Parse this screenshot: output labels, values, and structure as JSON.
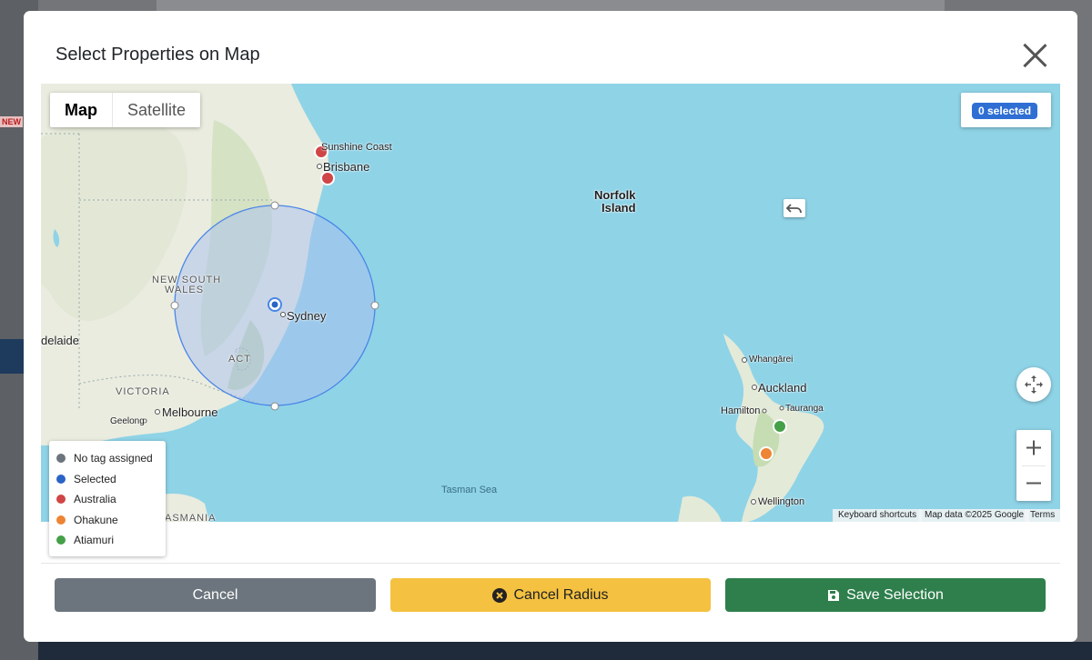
{
  "background": {
    "new_badge": "NEW"
  },
  "modal": {
    "title": "Select Properties on Map"
  },
  "map": {
    "type_controls": {
      "map": "Map",
      "satellite": "Satellite",
      "active": "Map"
    },
    "selected_count": "0 selected",
    "labels": {
      "sunshine_coast": "Sunshine Coast",
      "brisbane": "Brisbane",
      "norfolk": "Norfolk",
      "island": "Island",
      "new_south": "NEW SOUTH",
      "wales": "WALES",
      "sydney": "Sydney",
      "adelaide": "delaide",
      "act": "ACT",
      "victoria": "VICTORIA",
      "melbourne": "Melbourne",
      "geelong": "Geelong",
      "tasmania": "ASMANIA",
      "tasman_sea": "Tasman Sea",
      "whangarei": "Whangārei",
      "auckland": "Auckland",
      "hamilton": "Hamilton",
      "tauranga": "Tauranga",
      "wellington": "Wellington"
    },
    "attribution": {
      "keyboard": "Keyboard shortcuts",
      "data": "Map data ©2025 Google",
      "terms": "Terms"
    },
    "icons": {
      "fullscreen": "fullscreen-icon",
      "zoom_in": "plus-icon",
      "zoom_out": "minus-icon",
      "undo": "undo-icon"
    }
  },
  "legend": [
    {
      "label": "No tag assigned",
      "color": "#6c757d"
    },
    {
      "label": "Selected",
      "color": "#2a64c5"
    },
    {
      "label": "Australia",
      "color": "#d04545"
    },
    {
      "label": "Ohakune",
      "color": "#ee8435"
    },
    {
      "label": "Atiamuri",
      "color": "#45a047"
    }
  ],
  "buttons": {
    "cancel": "Cancel",
    "cancel_radius": "Cancel Radius",
    "save": "Save Selection"
  },
  "colors": {
    "water": "#8fd3e7",
    "land": "#e9ecdf",
    "radius_fill": "#a9c0f0",
    "radius_stroke": "#4a86e8"
  }
}
